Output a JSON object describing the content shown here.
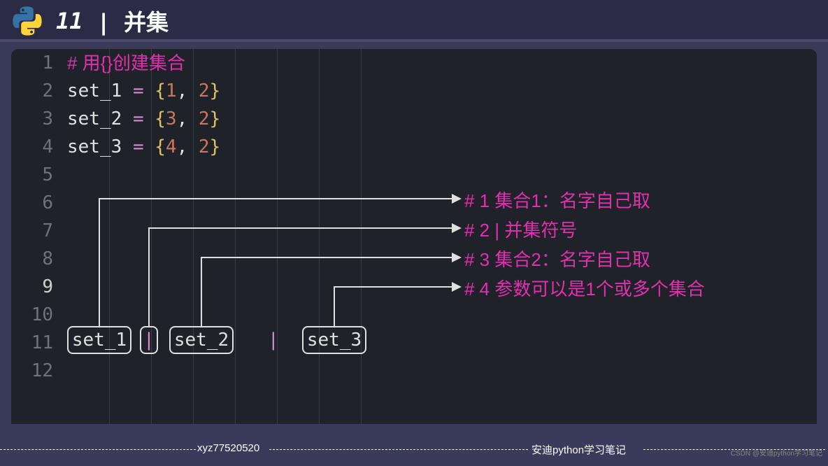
{
  "header": {
    "number": "11",
    "title": "| 并集"
  },
  "code": {
    "comment1": "# 用{}创建集合",
    "set1": {
      "name": "set_1",
      "eq": "=",
      "lb": "{",
      "v1": "1",
      "comma": ",",
      "v2": "2",
      "rb": "}"
    },
    "set2": {
      "name": "set_2",
      "eq": "=",
      "lb": "{",
      "v1": "3",
      "comma": ",",
      "v2": "2",
      "rb": "}"
    },
    "set3": {
      "name": "set_3",
      "eq": "=",
      "lb": "{",
      "v1": "4",
      "comma": ",",
      "v2": "2",
      "rb": "}"
    }
  },
  "annotations": {
    "a1": "# 1 集合1：名字自己取",
    "a2": "# 2 | 并集符号",
    "a3": "# 3 集合2：名字自己取",
    "a4": "# 4 参数可以是1个或多个集合"
  },
  "tokens": {
    "t1": "set_1",
    "t2": "|",
    "t3": "set_2",
    "pipe": "|",
    "t4": "set_3"
  },
  "line_numbers": [
    "1",
    "2",
    "3",
    "4",
    "5",
    "6",
    "7",
    "8",
    "9",
    "10",
    "11",
    "12"
  ],
  "footer": {
    "left": "xyz77520520",
    "right": "安迪python学习笔记"
  },
  "watermark": "CSDN @安迪python学习笔记"
}
